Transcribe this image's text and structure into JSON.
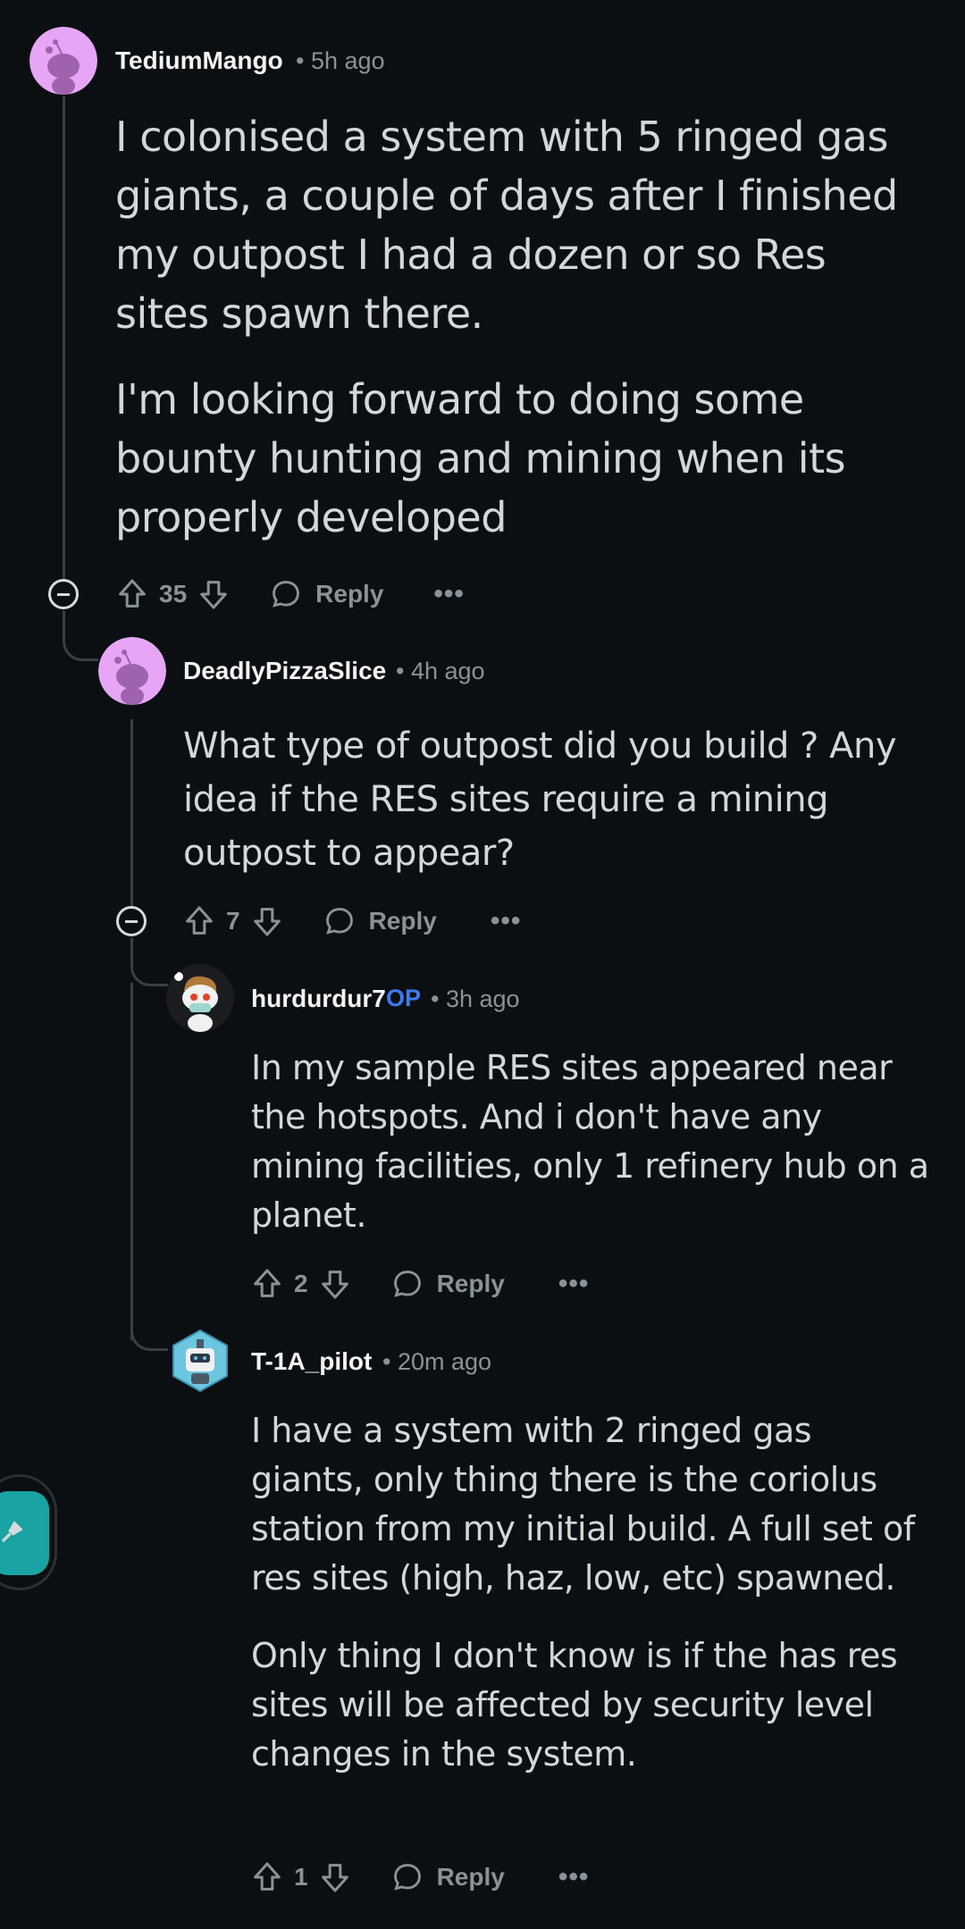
{
  "comments": [
    {
      "username": "TediumMango",
      "time": "• 5h ago",
      "paragraphs": [
        "I colonised a system with 5 ringed gas giants, a couple of days after I finished my outpost I had a dozen or so Res sites spawn there.",
        "I'm looking forward to doing some bounty hunting and mining when its properly developed"
      ],
      "votes": "35",
      "reply_label": "Reply",
      "more": "•••",
      "avatar_color": "#e7a6f5"
    },
    {
      "username": "DeadlyPizzaSlice",
      "time": "• 4h ago",
      "paragraphs": [
        "What type of outpost did you build ? Any idea if the RES sites require a mining outpost to appear?"
      ],
      "votes": "7",
      "reply_label": "Reply",
      "more": "•••",
      "avatar_color": "#e7a6f5"
    },
    {
      "username": "hurdurdur7",
      "op_badge": "OP",
      "time": "• 3h ago",
      "paragraphs": [
        "In my sample RES sites appeared near the hotspots. And i don't have any mining facilities, only 1 refinery hub on a planet."
      ],
      "votes": "2",
      "reply_label": "Reply",
      "more": "•••"
    },
    {
      "username": "T-1A_pilot",
      "time": "• 20m ago",
      "paragraphs": [
        "I have a system with 2 ringed gas giants, only thing there is the coriolus station from my initial build. A full set of res sites (high, haz, low, etc) spawned.",
        "Only thing I don't know is if the has res sites will be affected by security level changes in the system."
      ],
      "votes": "1",
      "reply_label": "Reply",
      "more": "•••"
    }
  ],
  "colors": {
    "background": "#0b0f12",
    "op_badge": "#3d7bf5",
    "floating_button": "#1aa3a3"
  },
  "icons": [
    "upvote-icon",
    "downvote-icon",
    "comment-bubble-icon",
    "more-options-icon",
    "collapse-icon",
    "floating-action-icon"
  ]
}
